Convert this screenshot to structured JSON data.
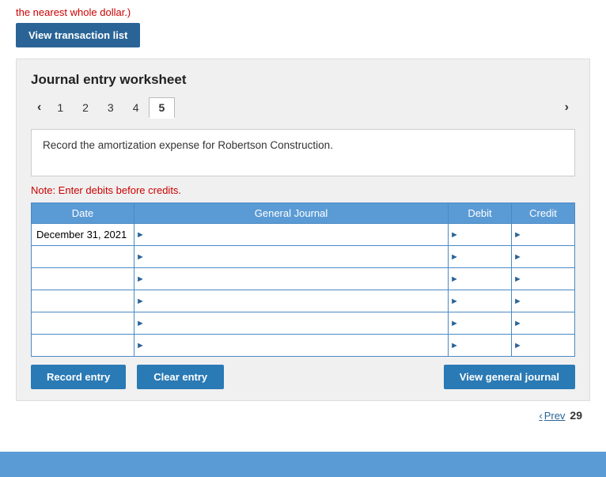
{
  "top_note": "the nearest whole dollar.)",
  "buttons": {
    "view_transaction": "View transaction list",
    "record_entry": "Record entry",
    "clear_entry": "Clear entry",
    "view_general_journal": "View general journal"
  },
  "worksheet": {
    "title": "Journal entry worksheet",
    "tabs": [
      1,
      2,
      3,
      4,
      5
    ],
    "active_tab": 5,
    "instruction": "Record the amortization expense for Robertson Construction.",
    "note": "Note: Enter debits before credits.",
    "table": {
      "headers": [
        "Date",
        "General Journal",
        "Debit",
        "Credit"
      ],
      "rows": [
        {
          "date": "December 31, 2021",
          "gj": "",
          "debit": "",
          "credit": ""
        },
        {
          "date": "",
          "gj": "",
          "debit": "",
          "credit": ""
        },
        {
          "date": "",
          "gj": "",
          "debit": "",
          "credit": ""
        },
        {
          "date": "",
          "gj": "",
          "debit": "",
          "credit": ""
        },
        {
          "date": "",
          "gj": "",
          "debit": "",
          "credit": ""
        },
        {
          "date": "",
          "gj": "",
          "debit": "",
          "credit": ""
        }
      ]
    }
  },
  "pagination": {
    "prev_label": "Prev",
    "page_number": "29"
  }
}
